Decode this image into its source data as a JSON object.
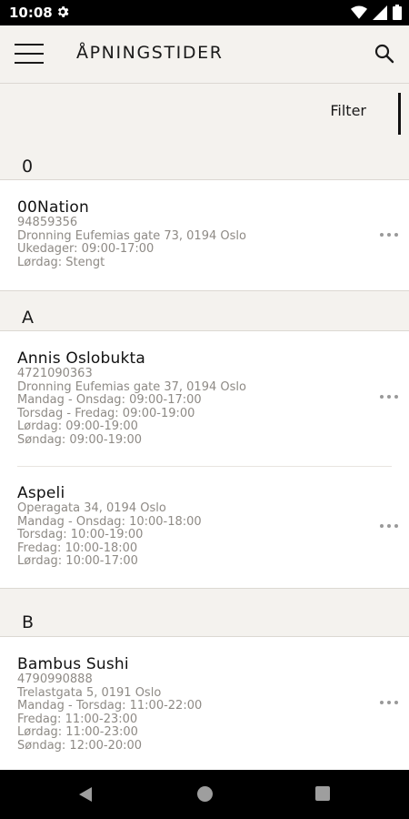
{
  "status": {
    "time": "10:08"
  },
  "appbar": {
    "title": "ÅPNINGSTIDER"
  },
  "filter": {
    "label": "Filter"
  },
  "sections": [
    {
      "letter": "0",
      "entries": [
        {
          "name": "00Nation",
          "lines": [
            "94859356",
            "Dronning Eufemias gate 73, 0194 Oslo",
            "Ukedager: 09:00-17:00",
            "Lørdag: Stengt"
          ]
        }
      ]
    },
    {
      "letter": "A",
      "entries": [
        {
          "name": "Annis Oslobukta",
          "lines": [
            "4721090363",
            "Dronning Eufemias gate 37, 0194 Oslo",
            "Mandag - Onsdag: 09:00-17:00",
            "Torsdag - Fredag: 09:00-19:00",
            "Lørdag: 09:00-19:00",
            "Søndag: 09:00-19:00"
          ]
        },
        {
          "name": "Aspeli",
          "lines": [
            "Operagata 34, 0194 Oslo",
            "Mandag - Onsdag: 10:00-18:00",
            "Torsdag: 10:00-19:00",
            "Fredag: 10:00-18:00",
            "Lørdag: 10:00-17:00"
          ]
        }
      ]
    },
    {
      "letter": "B",
      "entries": [
        {
          "name": "Bambus Sushi",
          "lines": [
            "4790990888",
            "Trelastgata 5, 0191 Oslo",
            "Mandag - Torsdag: 11:00-22:00",
            "Fredag: 11:00-23:00",
            "Lørdag: 11:00-23:00",
            "Søndag: 12:00-20:00"
          ]
        }
      ]
    }
  ]
}
